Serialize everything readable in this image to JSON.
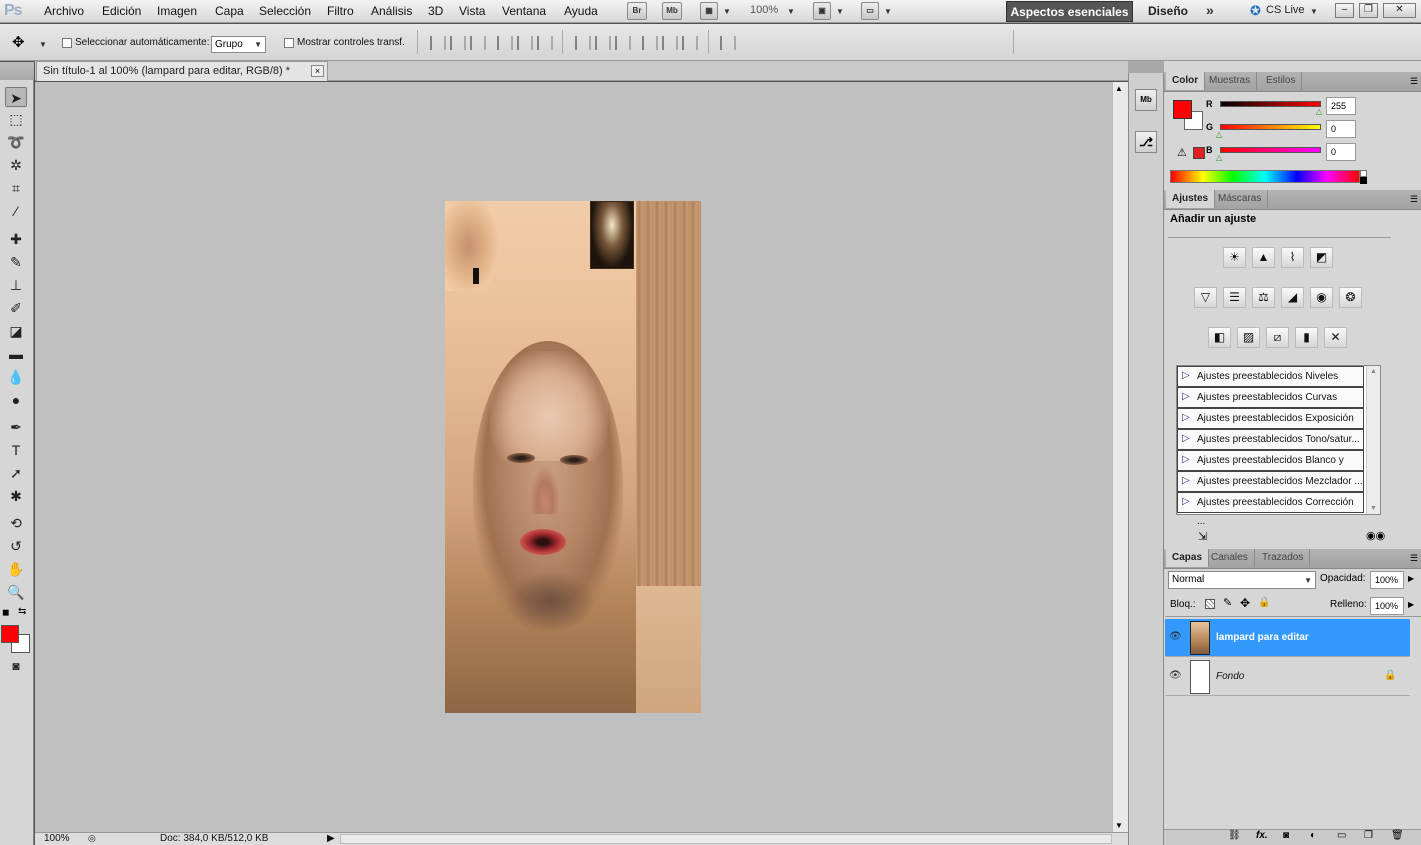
{
  "app": {
    "logo": "Ps"
  },
  "menu": {
    "items": [
      "Archivo",
      "Edición",
      "Imagen",
      "Capa",
      "Selección",
      "Filtro",
      "Análisis",
      "3D",
      "Vista",
      "Ventana",
      "Ayuda"
    ],
    "bridge_label": "Br",
    "minibridge_label": "Mb",
    "zoom": "100%",
    "workspace_active": "Aspectos esenciales",
    "workspace_other": "Diseño",
    "more": "»",
    "cslive": "CS Live"
  },
  "options": {
    "auto_select_label": "Seleccionar automáticamente:",
    "auto_select_value": "Grupo",
    "show_transform_label": "Mostrar controles transf."
  },
  "document": {
    "tab_title": "Sin título-1 al 100% (lampard para editar, RGB/8) *",
    "close": "×"
  },
  "status": {
    "zoom": "100%",
    "doc_info": "Doc: 384,0 KB/512,0 KB"
  },
  "color_panel": {
    "tabs": [
      "Color",
      "Muestras",
      "Estilos"
    ],
    "active_tab": "Color",
    "channels": [
      {
        "label": "R",
        "value": "255",
        "level": 1.0
      },
      {
        "label": "G",
        "value": "0",
        "level": 0.0
      },
      {
        "label": "B",
        "value": "0",
        "level": 0.0
      }
    ],
    "foreground": "#ff0000",
    "background": "#ffffff"
  },
  "adjust_panel": {
    "tabs": [
      "Ajustes",
      "Máscaras"
    ],
    "active_tab": "Ajustes",
    "heading": "Añadir un ajuste",
    "presets": [
      "Ajustes preestablecidos Niveles",
      "Ajustes preestablecidos Curvas",
      "Ajustes preestablecidos Exposición",
      "Ajustes preestablecidos Tono/satur...",
      "Ajustes preestablecidos Blanco y ne...",
      "Ajustes preestablecidos Mezclador ...",
      "Ajustes preestablecidos Corrección ..."
    ]
  },
  "layers_panel": {
    "tabs": [
      "Capas",
      "Canales",
      "Trazados"
    ],
    "active_tab": "Capas",
    "blend_mode": "Normal",
    "opacity_label": "Opacidad:",
    "opacity": "100%",
    "lock_label": "Bloq.:",
    "fill_label": "Relleno:",
    "fill": "100%",
    "layers": [
      {
        "name": "lampard para editar",
        "selected": true
      },
      {
        "name": "Fondo",
        "selected": false,
        "locked": true
      }
    ]
  },
  "colors": {
    "selection": "#3399ff",
    "foreground": "#ff0000",
    "workspace_active_bg": "#555555"
  }
}
